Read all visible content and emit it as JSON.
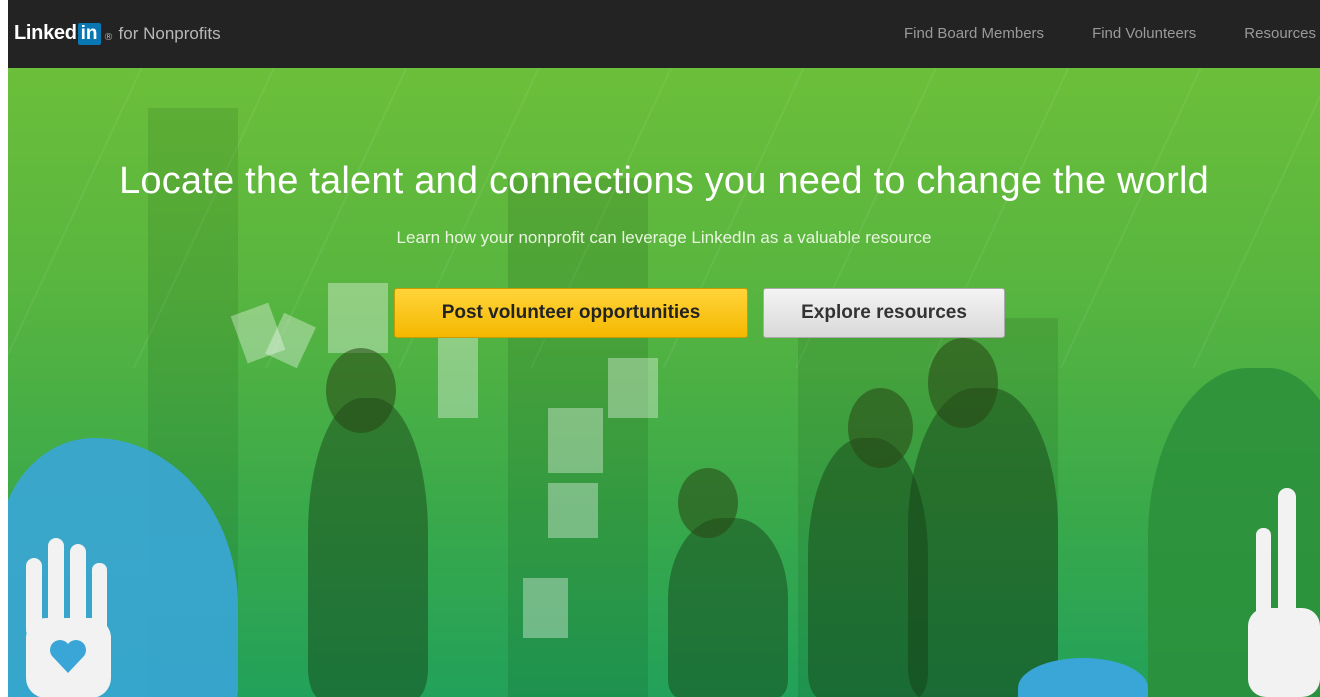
{
  "brand": {
    "linked": "Linked",
    "in": "in",
    "registered": "®",
    "suffix": "for Nonprofits"
  },
  "nav": {
    "items": [
      {
        "label": "Find Board Members"
      },
      {
        "label": "Find Volunteers"
      },
      {
        "label": "Resources"
      }
    ]
  },
  "hero": {
    "headline": "Locate the talent and connections you need to change the world",
    "subheadline": "Learn how your nonprofit can leverage LinkedIn as a valuable resource",
    "primary_button": "Post volunteer opportunities",
    "secondary_button": "Explore resources"
  },
  "colors": {
    "topbar": "#232323",
    "hero_green": "#58b53f",
    "primary_button": "#f5b800",
    "linkedin_blue": "#0a77b5",
    "accent_blue": "#3aa6d8"
  },
  "icons": [
    "hand-heart-icon",
    "hand-icon"
  ]
}
